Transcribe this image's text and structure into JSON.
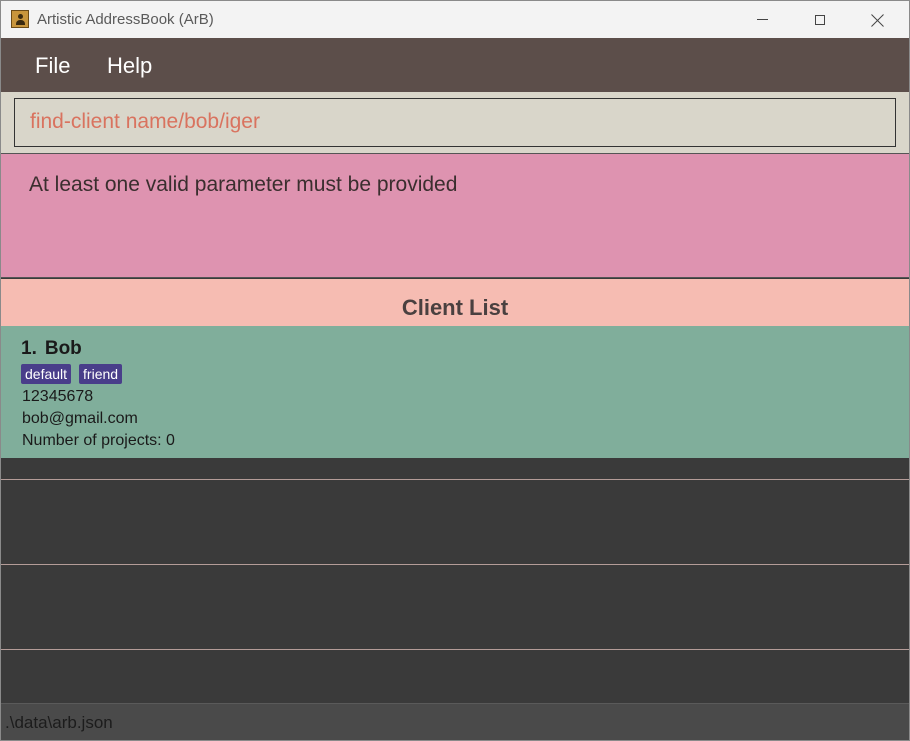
{
  "window": {
    "title": "Artistic AddressBook (ArB)"
  },
  "menu": {
    "file_label": "File",
    "help_label": "Help"
  },
  "command": {
    "value": "find-client name/bob/iger"
  },
  "result": {
    "message": "At least one valid parameter must be provided"
  },
  "client_list": {
    "header": "Client List",
    "clients": [
      {
        "index": "1.",
        "name": "Bob",
        "tags": [
          "default",
          "friend"
        ],
        "phone": "12345678",
        "email": "bob@gmail.com",
        "projects": "Number of projects: 0"
      }
    ]
  },
  "status": {
    "path": ".\\data\\arb.json"
  },
  "colors": {
    "menubar": "#5c4e4a",
    "command_bg": "#d9d6ca",
    "command_text": "#d9735f",
    "result_bg": "#de93b0",
    "header_bg": "#f6bcb2",
    "card_bg": "#80ae9b",
    "tag_bg": "#493e8a",
    "list_bg": "#3a3a3a"
  },
  "icons": {
    "app": "addressbook-icon",
    "minimize": "minimize-icon",
    "maximize": "maximize-icon",
    "close": "close-icon"
  }
}
